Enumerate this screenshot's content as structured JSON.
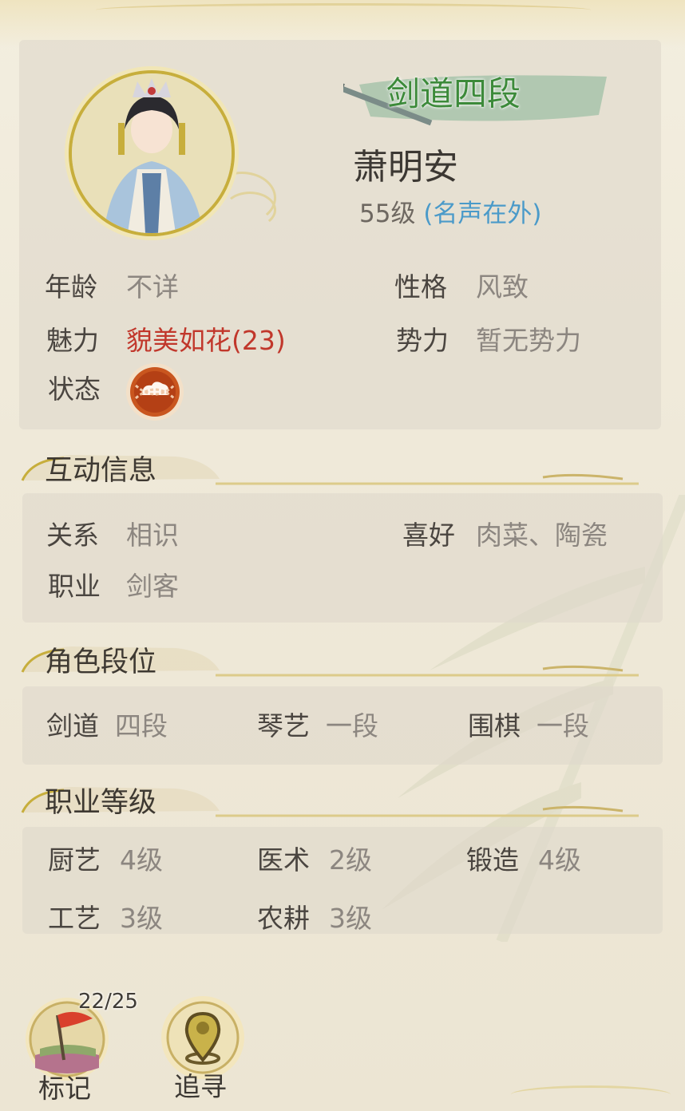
{
  "character": {
    "rank_title": "剑道四段",
    "name": "萧明安",
    "level": "55级",
    "fame": "(名声在外)"
  },
  "attributes": {
    "age_label": "年龄",
    "age_value": "不详",
    "personality_label": "性格",
    "personality_value": "风致",
    "charm_label": "魅力",
    "charm_value": "貌美如花(23)",
    "faction_label": "势力",
    "faction_value": "暂无势力",
    "status_label": "状态"
  },
  "interaction": {
    "title": "互动信息",
    "relation_label": "关系",
    "relation_value": "相识",
    "hobby_label": "喜好",
    "hobby_value": "肉菜、陶瓷",
    "job_label": "职业",
    "job_value": "剑客"
  },
  "ranks": {
    "title": "角色段位",
    "items": [
      {
        "label": "剑道",
        "value": "四段"
      },
      {
        "label": "琴艺",
        "value": "一段"
      },
      {
        "label": "围棋",
        "value": "一段"
      }
    ]
  },
  "professions": {
    "title": "职业等级",
    "items": [
      {
        "label": "厨艺",
        "value": "4级"
      },
      {
        "label": "医术",
        "value": "2级"
      },
      {
        "label": "锻造",
        "value": "4级"
      },
      {
        "label": "工艺",
        "value": "3级"
      },
      {
        "label": "农耕",
        "value": "3级"
      }
    ]
  },
  "actions": {
    "mark_label": "标记",
    "mark_count": "22/25",
    "seek_label": "追寻"
  },
  "colors": {
    "accent_gold": "#c7ae3c",
    "charm_red": "#c1372b",
    "fame_blue": "#4a9ac9",
    "rank_green": "#3c8a3a"
  },
  "icons": {
    "status": "chain-shackle-icon",
    "mark": "red-flag-icon",
    "seek": "location-pin-icon",
    "rank": "sword-icon"
  }
}
